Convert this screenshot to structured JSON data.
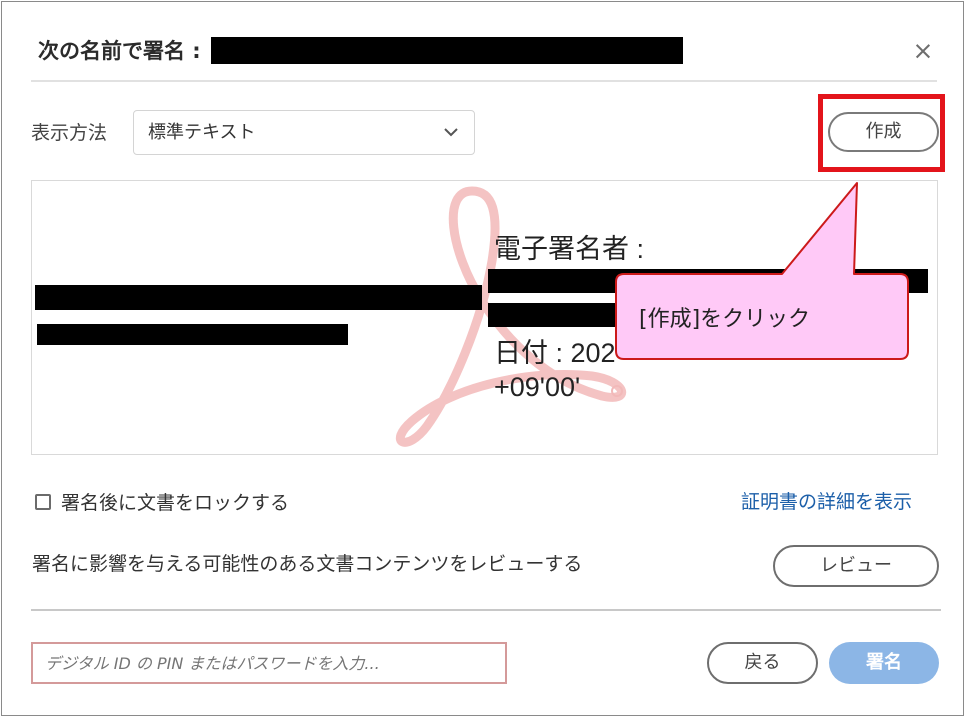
{
  "dialog": {
    "title": "次の名前で署名 :",
    "close_label": "×"
  },
  "display": {
    "label": "表示方法",
    "selected": "標準テキスト",
    "create_label": "作成"
  },
  "preview": {
    "signer_label": "電子署名者 :",
    "date_label": "日付 : 202",
    "tz": "+09'00'",
    "watermark_icon": "adobe-acrobat-watermark-icon"
  },
  "callout": {
    "text": "[作成]をクリック",
    "fill": "#ffc9f7",
    "stroke": "#cc1a1a"
  },
  "options": {
    "lock_label": "署名後に文書をロックする",
    "lock_checked": false,
    "cert_link": "証明書の詳細を表示",
    "review_text": "署名に影響を与える可能性のある文書コンテンツをレビューする",
    "review_button": "レビュー"
  },
  "footer": {
    "pin_placeholder": "デジタル ID の PIN またはパスワードを入力...",
    "back_label": "戻る",
    "sign_label": "署名"
  },
  "colors": {
    "link": "#1c5fa9",
    "primary_disabled": "#8cb6e6",
    "highlight": "#e3141b"
  }
}
